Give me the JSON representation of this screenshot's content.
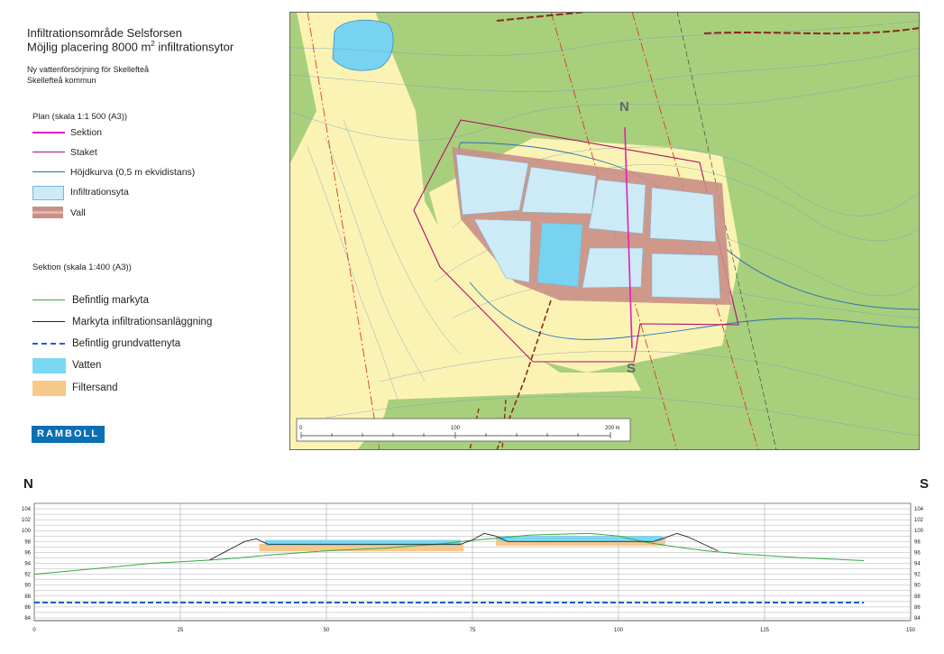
{
  "title": {
    "line1": "Infiltrationsområde Selsforsen",
    "line2_prefix": "Möjlig placering 8000 m",
    "line2_sup": "2",
    "line2_suffix": " infiltrationsytor"
  },
  "subtitle": {
    "line1": "Ny vattenförsörjning för Skellefteå",
    "line2": "Skellefteå kommun"
  },
  "plan_legend": {
    "heading": "Plan (skala 1:1 500 (A3))",
    "items": [
      {
        "label": "Sektion",
        "color": "#e020b8"
      },
      {
        "label": "Staket",
        "color": "#b0106a"
      },
      {
        "label": "Höjdkurva (0,5 m ekvidistans)",
        "color": "#2a6fb8"
      },
      {
        "label": "Infiltrationsyta",
        "color": "#cdeaf7"
      },
      {
        "label": "Vall",
        "color": "#c98f86"
      }
    ]
  },
  "section_legend": {
    "heading": "Sektion (skala 1:400 (A3))",
    "items": [
      {
        "label": "Befintlig markyta",
        "color": "#3aa845"
      },
      {
        "label": "Markyta infiltrationsanläggning",
        "color": "#222222"
      },
      {
        "label": "Befintlig grundvattenyta",
        "color": "#1f5fd6"
      },
      {
        "label": "Vatten",
        "color": "#7ad8f2"
      },
      {
        "label": "Filtersand",
        "color": "#f6c98a"
      }
    ]
  },
  "logo": "RAMBOLL",
  "map": {
    "north_label": "N",
    "south_label": "S",
    "scale_labels": [
      "0",
      "100",
      "200 m"
    ],
    "colors": {
      "forest": "#a8cf7c",
      "open": "#fbf3b4",
      "water": "#77d3f0"
    }
  },
  "section": {
    "left_label": "N",
    "right_label": "S",
    "x_ticks": [
      "0",
      "25",
      "50",
      "75",
      "100",
      "125",
      "150"
    ],
    "y_ticks": [
      "104",
      "102",
      "100",
      "98",
      "96",
      "94",
      "92",
      "90",
      "88",
      "86",
      "84"
    ]
  },
  "chart_data": {
    "type": "line",
    "xlim": [
      0,
      150
    ],
    "ylim": [
      83.5,
      105
    ],
    "series": [
      {
        "name": "Befintlig markyta",
        "x": [
          0,
          10,
          20,
          25,
          30,
          35,
          40,
          50,
          60,
          70,
          73,
          78,
          85,
          95,
          100,
          105,
          110,
          115,
          120,
          130,
          140,
          142
        ],
        "y": [
          92,
          93,
          94,
          94.3,
          94.6,
          95,
          95.5,
          96.3,
          96.8,
          97.6,
          98.0,
          98.5,
          99.2,
          99.5,
          99.0,
          97.8,
          97.0,
          96.3,
          95.8,
          95.1,
          94.6,
          94.5
        ]
      },
      {
        "name": "Markyta infiltrationsanläggning",
        "x": [
          30,
          36,
          38,
          40,
          73,
          75,
          77,
          79,
          81,
          106,
          108,
          110,
          112,
          117
        ],
        "y": [
          94.6,
          98,
          98.5,
          97.5,
          97.5,
          98.3,
          99.5,
          99.0,
          98.0,
          98.0,
          98.7,
          99.5,
          98.8,
          96.3
        ]
      },
      {
        "name": "Befintlig grundvattenyta",
        "x": [
          0,
          142
        ],
        "y": [
          86.8,
          86.8
        ]
      }
    ],
    "areas": [
      {
        "name": "Filtersand",
        "x": [
          38.5,
          73.5
        ],
        "y": [
          96.2,
          97.6
        ]
      },
      {
        "name": "Vatten",
        "x": [
          39.5,
          73
        ],
        "y": [
          97.2,
          98.3
        ]
      },
      {
        "name": "Filtersand",
        "x": [
          79,
          108
        ],
        "y": [
          97.2,
          98.8
        ]
      },
      {
        "name": "Vatten",
        "x": [
          79.5,
          107.5
        ],
        "y": [
          98.0,
          99.0
        ]
      }
    ]
  }
}
